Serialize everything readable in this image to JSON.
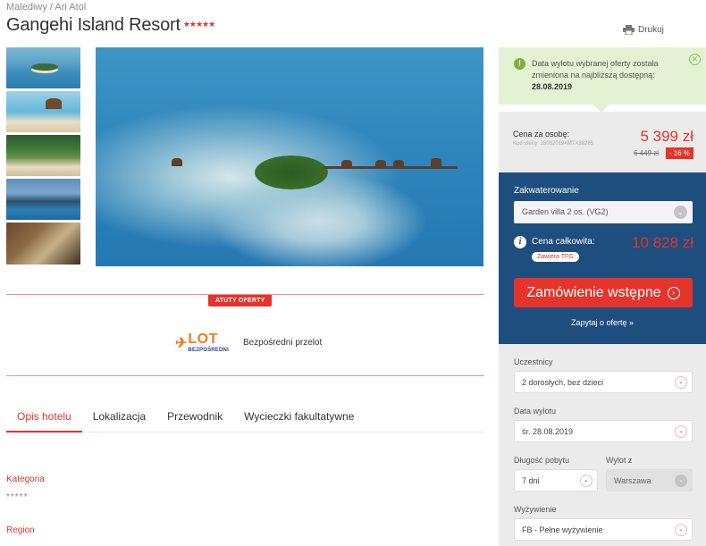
{
  "breadcrumb": "Malediwy / Ari Atol",
  "title": "Gangehi Island Resort",
  "stars": "★★★★★",
  "print_label": "Drukuj",
  "atuty_label": "ATUTY OFERTY",
  "flight": {
    "logo_text": "LOT",
    "logo_sub": "BEZPOŚREDNI",
    "label": "Bezpośredni przelot"
  },
  "tabs": [
    "Opis hotelu",
    "Lokalizacja",
    "Przewodnik",
    "Wycieczki fakultatywne"
  ],
  "details": {
    "category_label": "Kategoria",
    "category_value": "*****",
    "region_label": "Region"
  },
  "notice": {
    "text": "Data wylotu wybranej oferty została zmieniona na najbliższą dostępną:",
    "date": "28.08.2019"
  },
  "price": {
    "label": "Cena za osobę:",
    "offer_code": "Kod oferty: 280820194MTX88265",
    "current": "5 399 zł",
    "old": "6 449 zł",
    "discount": "- 16 %"
  },
  "booking": {
    "accommodation_label": "Zakwaterowanie",
    "accommodation_value": "Garden villa 2 os. (VG2)",
    "total_label": "Cena całkowita:",
    "tfg_badge": "Zawiera TFG",
    "total_price": "10 828 zł",
    "order_button": "Zamówienie wstępne",
    "ask_link": "Zapytaj o ofertę »"
  },
  "form": {
    "participants_label": "Uczestnicy",
    "participants_value": "2 dorosłych, bez dzieci",
    "departure_label": "Data wylotu",
    "departure_value": "śr. 28.08.2019",
    "duration_label": "Długość pobytu",
    "duration_value": "7 dni",
    "from_label": "Wylot z",
    "from_value": "Warszawa",
    "board_label": "Wyżywienie",
    "board_value": "FB - Pełne wyżywienie"
  },
  "colors": {
    "accent": "#e4342c",
    "booking_bg": "#1e4e7d",
    "notice_bg": "#e3f2d2",
    "lot_orange": "#f07b1c"
  }
}
